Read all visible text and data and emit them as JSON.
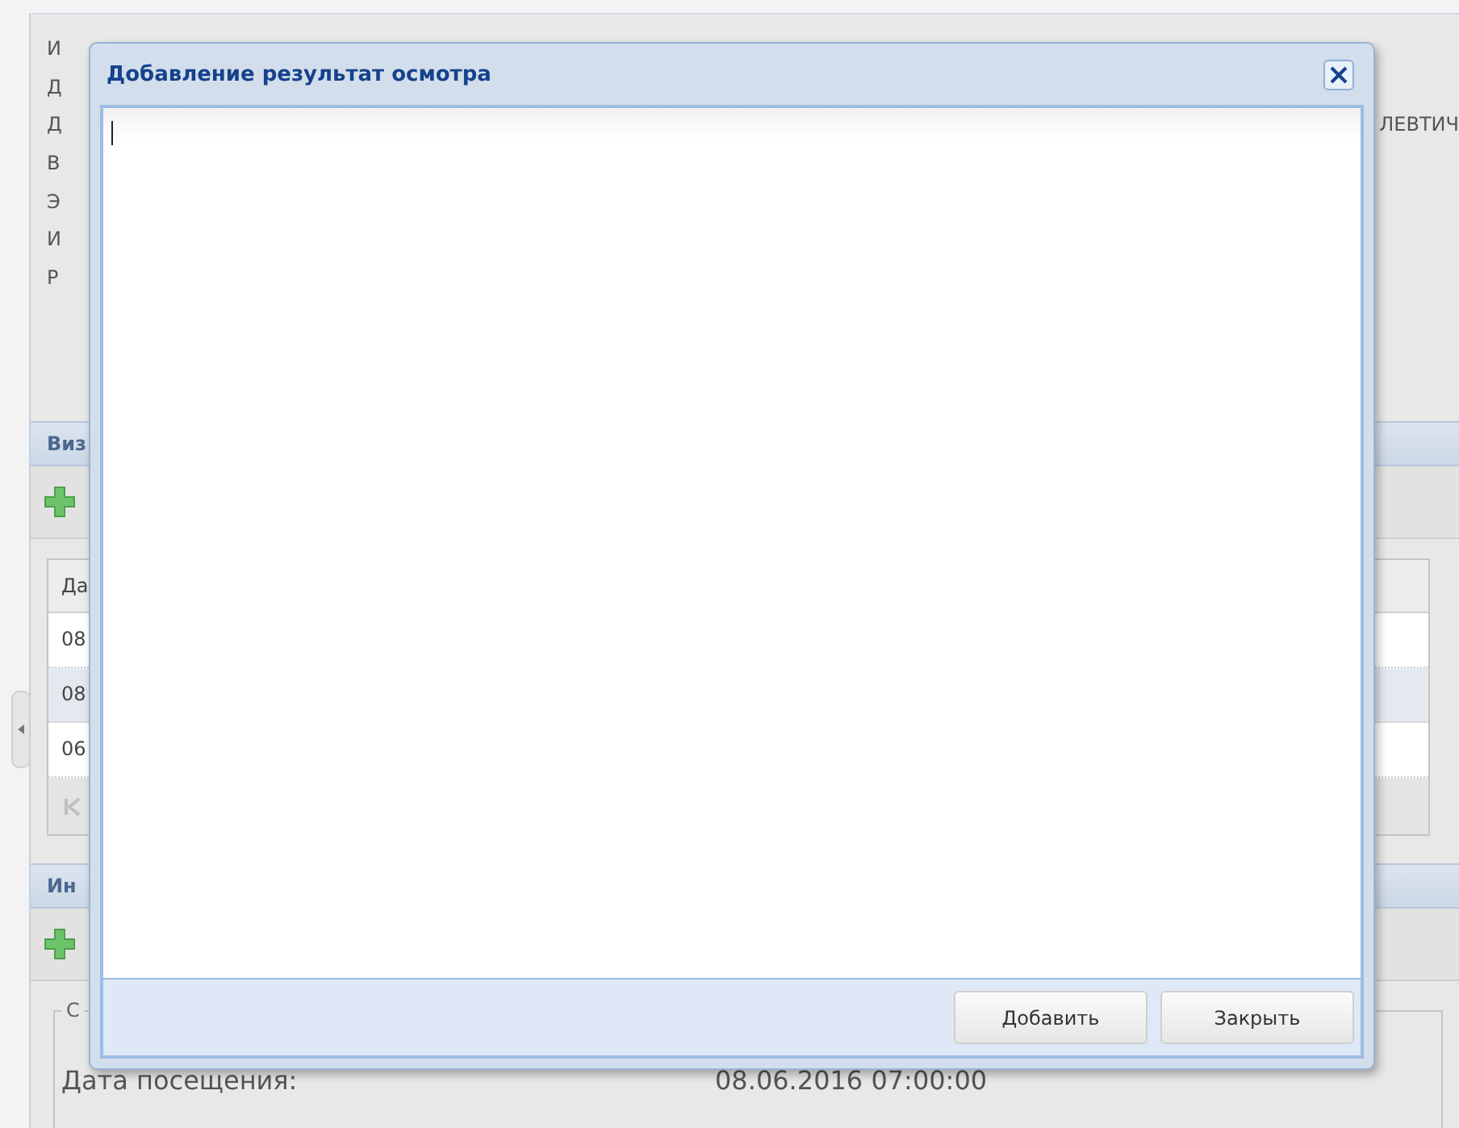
{
  "background": {
    "details": [
      {
        "label": "И"
      },
      {
        "label": "Д"
      },
      {
        "label": "Д",
        "value": "ЛЕВТИЧ"
      },
      {
        "label": "В"
      },
      {
        "label": "Э"
      },
      {
        "label": "И"
      },
      {
        "label": "Р"
      }
    ],
    "visits": {
      "title": "Виз",
      "column": "Да",
      "rows": [
        {
          "cell": "08",
          "selected": false
        },
        {
          "cell": "08",
          "selected": true
        },
        {
          "cell": "06",
          "selected": false
        }
      ]
    },
    "info": {
      "title": "Ин",
      "legend": "С",
      "date_label": "Дата посещения:",
      "date_value": "08.06.2016 07:00:00"
    }
  },
  "dialog": {
    "title": "Добавление результат осмотра",
    "buttons": [
      "Добавить",
      "Закрыть"
    ]
  }
}
